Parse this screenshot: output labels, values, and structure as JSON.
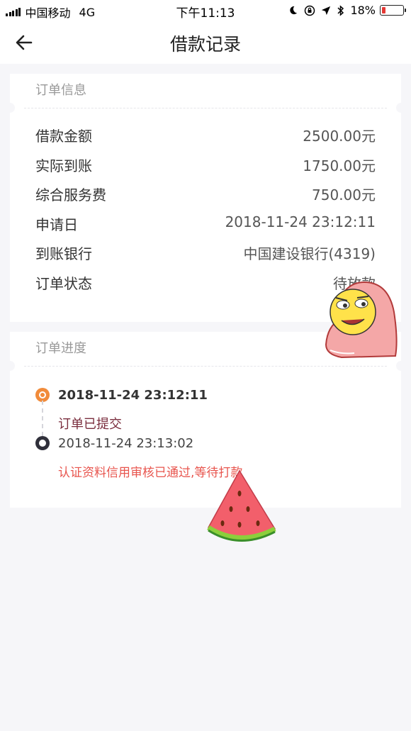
{
  "status_bar": {
    "carrier": "中国移动",
    "network": "4G",
    "time": "下午11:13",
    "battery": "18%",
    "battery_level": 0.18,
    "icons": [
      "moon-icon",
      "rotation-lock-icon",
      "location-icon",
      "bluetooth-icon",
      "battery-icon"
    ]
  },
  "nav": {
    "title": "借款记录",
    "back_icon": "back-arrow-icon"
  },
  "order_info": {
    "heading": "订单信息",
    "rows": [
      {
        "label": "借款金额",
        "value": "2500.00元"
      },
      {
        "label": "实际到账",
        "value": "1750.00元"
      },
      {
        "label": "综合服务费",
        "value": "750.00元"
      },
      {
        "label": "申请日",
        "value": "2018-11-24 23:12:11"
      },
      {
        "label": "到账银行",
        "value": "中国建设银行(4319)"
      },
      {
        "label": "订单状态",
        "value": "待放款"
      }
    ]
  },
  "progress": {
    "heading": "订单进度",
    "steps": [
      {
        "date": "2018-11-24 23:12:11",
        "text": "订单已提交"
      },
      {
        "date": "2018-11-24 23:13:02",
        "text": "认证资料信用审核已通过,等待打款"
      }
    ]
  },
  "colors": {
    "accent_orange": "#f18b3a",
    "step1_text": "#7a2d3d",
    "step2_text": "#e8554e",
    "background": "#f6f6f9"
  }
}
